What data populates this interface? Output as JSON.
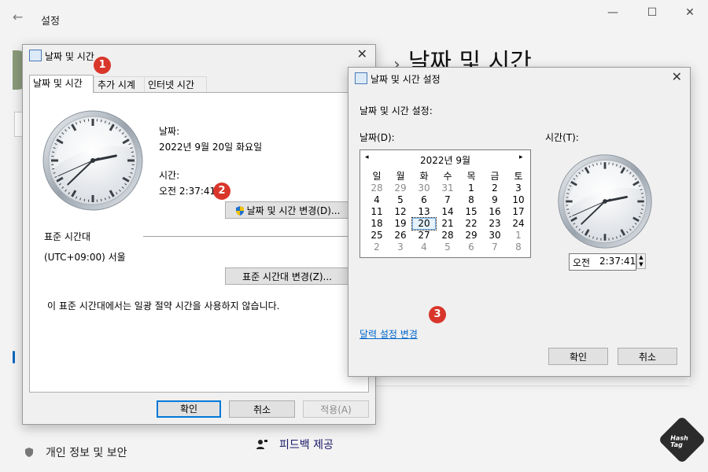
{
  "settings": {
    "title": "설정",
    "back_icon": "back-arrow-icon",
    "heading_chevron": "›",
    "heading": "날짜 및 시간",
    "window_controls": {
      "minimize": "—",
      "maximize": "☐",
      "close": "✕"
    },
    "sidebar": {
      "items": [
        {
          "label": "개인 정보 및 보안",
          "icon": "shield-icon"
        }
      ]
    },
    "feedback_label": "피드백 제공",
    "watermark": "Hash Tag"
  },
  "main_dialog": {
    "title": "날짜 및 시간",
    "tabs": [
      {
        "label": "날짜 및 시간"
      },
      {
        "label": "추가 시계"
      },
      {
        "label": "인터넷 시간"
      }
    ],
    "date_label": "날짜:",
    "date_value": "2022년 9월 20일 화요일",
    "time_label": "시간:",
    "time_value": "오전 2:37:41",
    "change_datetime_button": "날짜 및 시간 변경(D)...",
    "timezone_section": "표준 시간대",
    "timezone_value": "(UTC+09:00) 서울",
    "change_timezone_button": "표준 시간대 변경(Z)...",
    "dst_note": "이 표준 시간대에서는 일광 절약 시간을 사용하지 않습니다.",
    "ok_button": "확인",
    "cancel_button": "취소",
    "apply_button": "적용(A)",
    "clock": {
      "hour": 2,
      "minute": 37,
      "second": 41
    }
  },
  "datetime_dialog": {
    "title": "날짜 및 시간 설정",
    "heading": "날짜 및 시간 설정:",
    "date_label": "날짜(D):",
    "time_label": "시간(T):",
    "calendar": {
      "month_label": "2022년 9월",
      "prev": "◂",
      "next": "▸",
      "weekdays": [
        "일",
        "월",
        "화",
        "수",
        "목",
        "금",
        "토"
      ],
      "days": [
        [
          "28",
          "29",
          "30",
          "31",
          "1",
          "2",
          "3"
        ],
        [
          "4",
          "5",
          "6",
          "7",
          "8",
          "9",
          "10"
        ],
        [
          "11",
          "12",
          "13",
          "14",
          "15",
          "16",
          "17"
        ],
        [
          "18",
          "19",
          "20",
          "21",
          "22",
          "23",
          "24"
        ],
        [
          "25",
          "26",
          "27",
          "28",
          "29",
          "30",
          "1"
        ],
        [
          "2",
          "3",
          "4",
          "5",
          "6",
          "7",
          "8"
        ]
      ],
      "selected_day": "20"
    },
    "time_ampm": "오전",
    "time_value": "2:37:41",
    "spin_up": "▲",
    "spin_down": "▼",
    "calendar_settings_link": "달력 설정 변경",
    "ok_button": "확인",
    "cancel_button": "취소",
    "clock": {
      "hour": 2,
      "minute": 37,
      "second": 41
    }
  },
  "badges": [
    "1",
    "2",
    "3"
  ],
  "colors": {
    "accent": "#0078d7",
    "badge": "#d9362b",
    "link": "#0066cc"
  }
}
